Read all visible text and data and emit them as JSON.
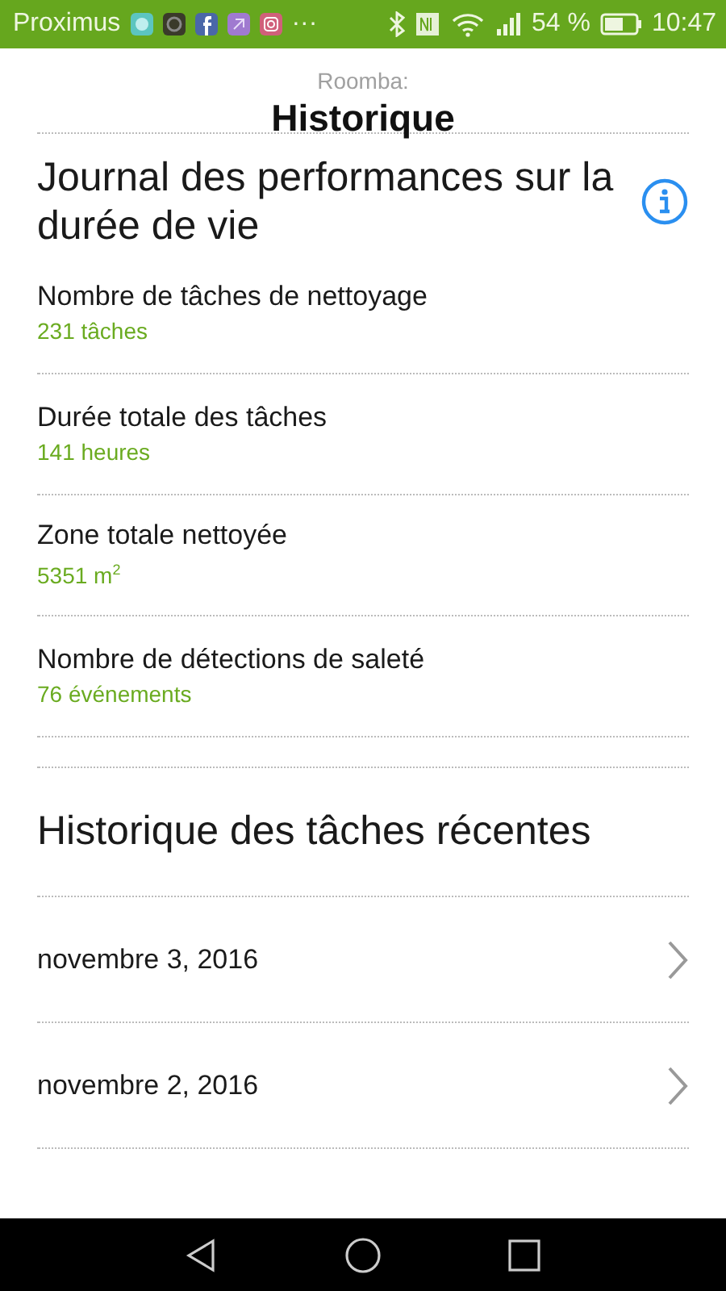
{
  "status_bar": {
    "carrier": "Proximus",
    "more": "···",
    "battery_percent": "54 %",
    "time": "10:47"
  },
  "header": {
    "subtitle": "Roomba:",
    "title": "Historique"
  },
  "lifetime": {
    "title": "Journal des performances sur la durée de vie",
    "stats": [
      {
        "label": "Nombre de tâches de nettoyage",
        "value": "231 tâches"
      },
      {
        "label": "Durée totale des tâches",
        "value": "141 heures"
      },
      {
        "label": "Zone totale nettoyée",
        "value": "5351 m$^{2}$"
      },
      {
        "label": "Nombre de détections de saleté",
        "value": "76 événements"
      }
    ]
  },
  "recent": {
    "title": "Historique des tâches récentes",
    "items": [
      {
        "date": "novembre 3, 2016"
      },
      {
        "date": "novembre 2, 2016"
      }
    ]
  }
}
